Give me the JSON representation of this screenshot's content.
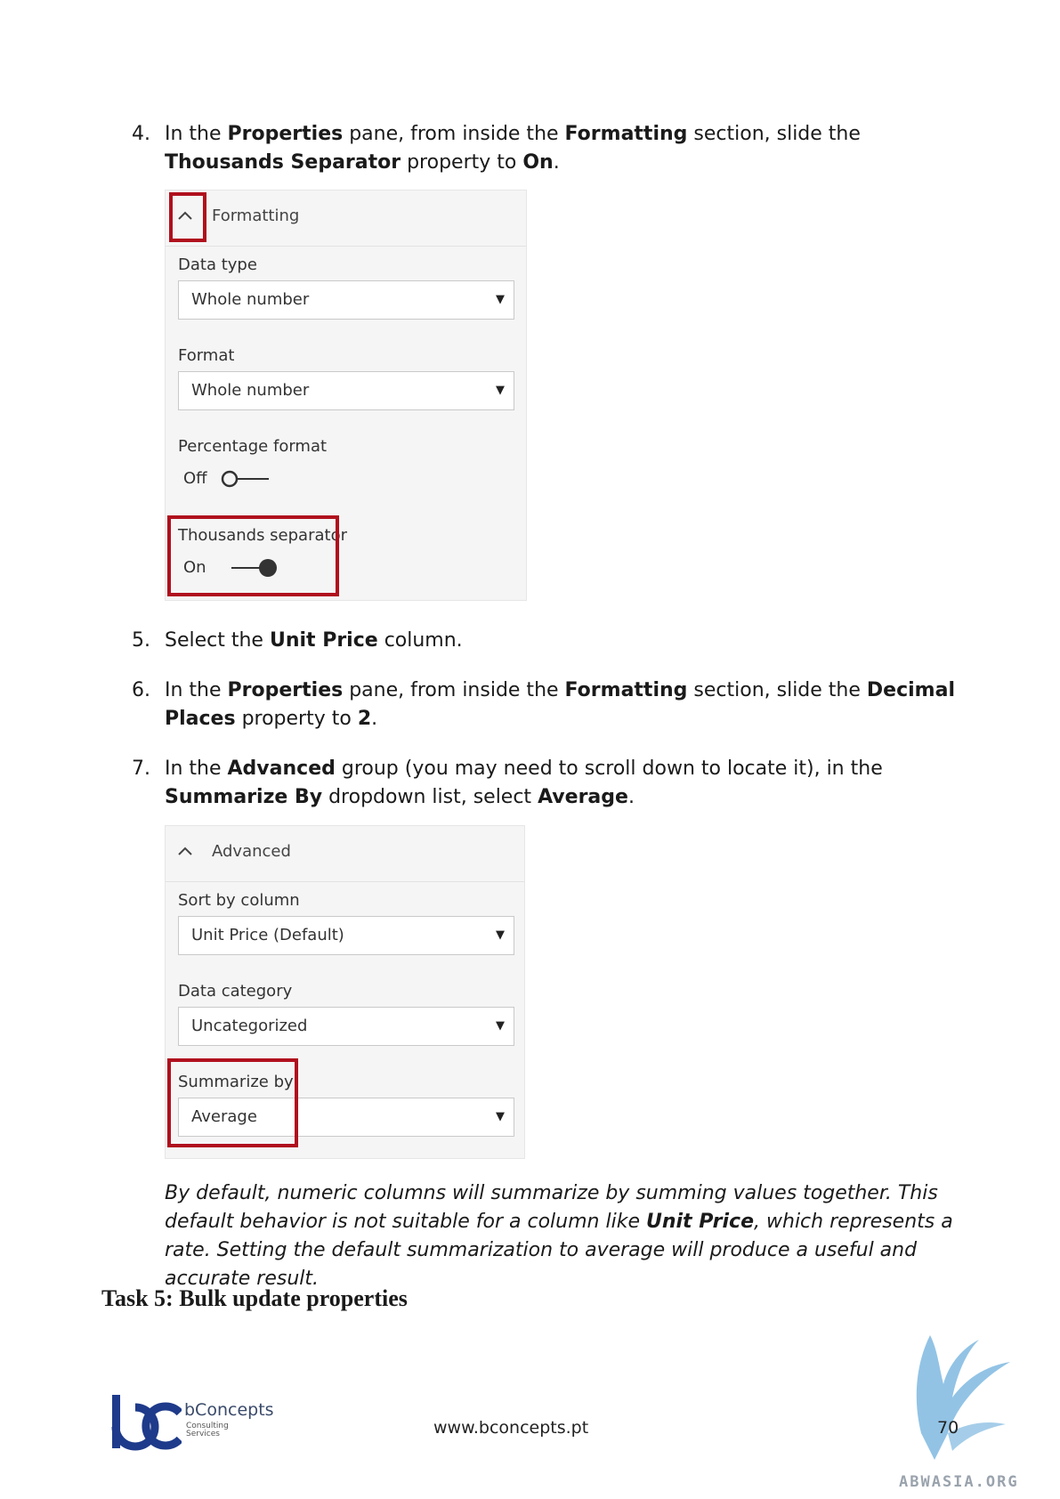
{
  "steps": [
    {
      "num": "4.",
      "parts": [
        {
          "t": "In the "
        },
        {
          "t": "Properties",
          "b": true
        },
        {
          "t": " pane, from inside the "
        },
        {
          "t": "Formatting",
          "b": true
        },
        {
          "t": " section, slide the "
        },
        {
          "t": "Thousands Separator",
          "b": true
        },
        {
          "t": " property to "
        },
        {
          "t": "On",
          "b": true
        },
        {
          "t": "."
        }
      ]
    },
    {
      "num": "5.",
      "parts": [
        {
          "t": "Select the "
        },
        {
          "t": "Unit Price",
          "b": true
        },
        {
          "t": " column."
        }
      ]
    },
    {
      "num": "6.",
      "parts": [
        {
          "t": "In the "
        },
        {
          "t": "Properties",
          "b": true
        },
        {
          "t": " pane, from inside the "
        },
        {
          "t": "Formatting",
          "b": true
        },
        {
          "t": " section, slide the "
        },
        {
          "t": "Decimal Places",
          "b": true
        },
        {
          "t": " property to "
        },
        {
          "t": "2",
          "b": true
        },
        {
          "t": "."
        }
      ]
    },
    {
      "num": "7.",
      "parts": [
        {
          "t": "In the "
        },
        {
          "t": "Advanced",
          "b": true
        },
        {
          "t": " group (you may need to scroll down to locate it), in the "
        },
        {
          "t": "Summarize By",
          "b": true
        },
        {
          "t": " dropdown list, select "
        },
        {
          "t": "Average",
          "b": true
        },
        {
          "t": "."
        }
      ]
    }
  ],
  "formatting_panel": {
    "title": "Formatting",
    "data_type_label": "Data type",
    "data_type_value": "Whole number",
    "format_label": "Format",
    "format_value": "Whole number",
    "percentage_label": "Percentage format",
    "percentage_state": "Off",
    "thousands_label": "Thousands separator",
    "thousands_state": "On"
  },
  "advanced_panel": {
    "title": "Advanced",
    "sort_label": "Sort by column",
    "sort_value": "Unit Price (Default)",
    "category_label": "Data category",
    "category_value": "Uncategorized",
    "summarize_label": "Summarize by",
    "summarize_value": "Average"
  },
  "note": {
    "parts": [
      {
        "t": "By default, numeric columns will summarize by summing values together. This default behavior is not suitable for a column like "
      },
      {
        "t": "Unit Price",
        "b": true
      },
      {
        "t": ", which represents a rate. Setting the default summarization to average will produce a useful and accurate result."
      }
    ]
  },
  "task_heading": "Task 5: Bulk update properties",
  "footer": {
    "brand_name": "bConcepts",
    "brand_sub_1": "Consulting",
    "brand_sub_2": "Services",
    "url": "www.bconcepts.pt",
    "page_number": "70",
    "watermark": "ABWASIA.ORG"
  },
  "colors": {
    "highlight": "#b0101d",
    "brand_blue": "#1e3a8a",
    "watermark": "#7fb8e0"
  }
}
